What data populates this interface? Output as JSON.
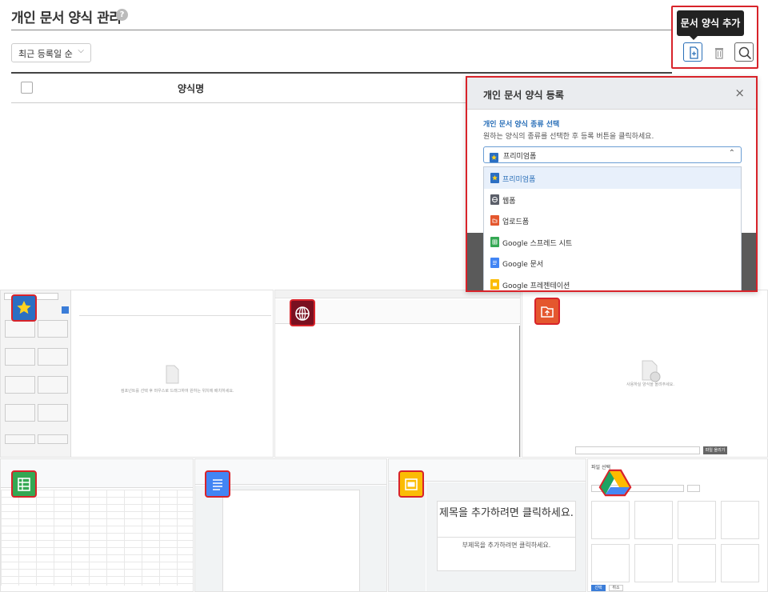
{
  "page": {
    "title": "개인 문서 양식 관리",
    "help_icon": "?"
  },
  "toolbar": {
    "sort_label": "최근 등록일 순",
    "tooltip": "문서 양식 추가",
    "add_icon": "add-document-icon",
    "delete_icon": "trash-icon",
    "search_icon": "search-icon"
  },
  "table": {
    "column_name": "양식명"
  },
  "dialog": {
    "title": "개인 문서 양식 등록",
    "close": "×",
    "section_label": "개인 문서 양식 종류 선택",
    "description": "원하는 양식의 종류를 선택한 후 등록 버튼을 클릭하세요.",
    "selected": "프리미엄폼",
    "options": [
      {
        "label": "프리미엄폼",
        "icon": "star-icon",
        "color": "#2b6fc3"
      },
      {
        "label": "웹폼",
        "icon": "globe-icon",
        "color": "#5b5f69"
      },
      {
        "label": "업로드폼",
        "icon": "upload-icon",
        "color": "#e4572e"
      },
      {
        "label": "Google 스프레드 시트",
        "icon": "sheets-icon",
        "color": "#34a853"
      },
      {
        "label": "Google 문서",
        "icon": "docs-icon",
        "color": "#4285f4"
      },
      {
        "label": "Google 프레젠테이션",
        "icon": "slides-icon",
        "color": "#fbbc04"
      }
    ]
  },
  "previews": {
    "premium_canvas_text": "컴포넌트를 선택 후 마우스로 드래그하여 원하는 위치에 배치하세요.",
    "upload_text": "사용하실 양식을 올려주세요.",
    "upload_button": "파일 올리기",
    "slide_title": "제목을 추가하려면 클릭하세요.",
    "slide_subtitle": "부제목을 추가하려면 클릭하세요.",
    "drive_title": "파일 선택",
    "drive_confirm": "선택",
    "drive_cancel": "취소"
  },
  "colors": {
    "accent": "#2a6fb8",
    "highlight_border": "#d8232a",
    "premium": "#2b6fc3",
    "web": "#7a1020",
    "upload": "#e4572e",
    "sheets": "#34a853",
    "docs": "#4285f4",
    "slides": "#fbbc04"
  }
}
